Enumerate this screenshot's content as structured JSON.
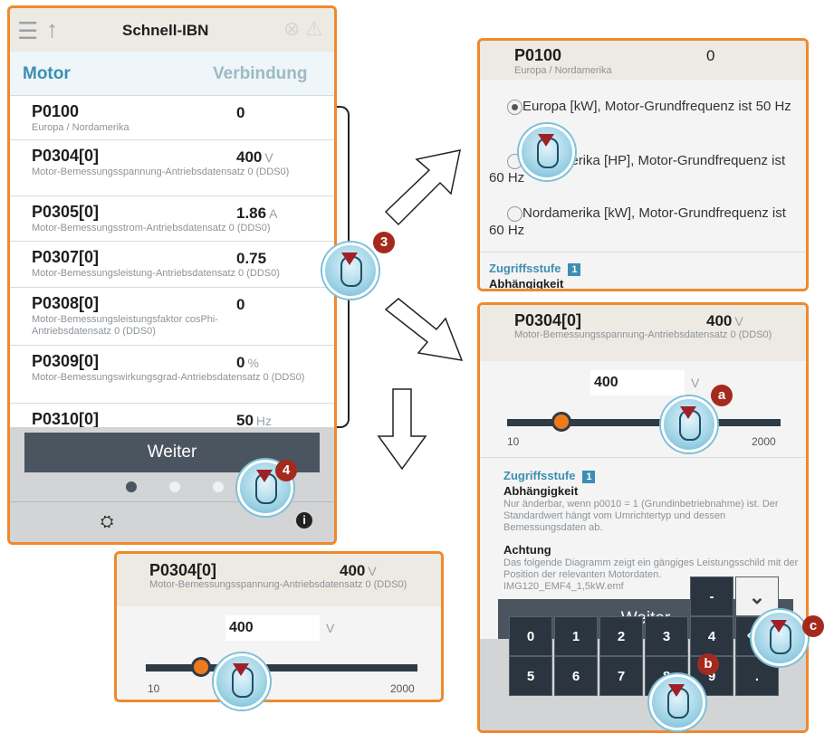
{
  "main": {
    "header_title": "Schnell-IBN",
    "tab_left": "Motor",
    "tab_right": "Verbindung",
    "params": [
      {
        "name": "P0100",
        "value": "0",
        "unit": "",
        "desc": "Europa / Nordamerika"
      },
      {
        "name": "P0304[0]",
        "value": "400",
        "unit": "V",
        "desc": "Motor-Bemessungsspannung-Antriebsdatensatz 0 (DDS0)"
      },
      {
        "name": "P0305[0]",
        "value": "1.86",
        "unit": "A",
        "desc": "Motor-Bemessungsstrom-Antriebsdatensatz 0 (DDS0)"
      },
      {
        "name": "P0307[0]",
        "value": "0.75",
        "unit": "",
        "desc": "Motor-Bemessungsleistung-Antriebsdatensatz 0 (DDS0)"
      },
      {
        "name": "P0308[0]",
        "value": "0",
        "unit": "",
        "desc": "Motor-Bemessungsleistungsfaktor cosPhi-Antriebsdatensatz 0 (DDS0)"
      },
      {
        "name": "P0309[0]",
        "value": "0",
        "unit": "%",
        "desc": "Motor-Bemessungswirkungsgrad-Antriebsdatensatz 0 (DDS0)"
      },
      {
        "name": "P0310[0]",
        "value": "50",
        "unit": "Hz",
        "desc": ""
      }
    ],
    "weiter_label": "Weiter",
    "page_indicator": {
      "total": 4,
      "active": 1
    }
  },
  "region_panel": {
    "param": "P0100",
    "value": "0",
    "desc": "Europa / Nordamerika",
    "options": [
      {
        "text": "Europa [kW], Motor-Grundfrequenz ist 50 Hz",
        "selected": true
      },
      {
        "text": "Nordamerika [HP], Motor-Grundfrequenz ist 60 Hz",
        "selected": false
      },
      {
        "text": "Nordamerika [kW], Motor-Grundfrequenz ist 60 Hz",
        "selected": false
      }
    ],
    "access_label": "Zugriffsstufe",
    "access_level": "1",
    "dependency_label": "Abhängigkeit"
  },
  "voltage_panel": {
    "param": "P0304[0]",
    "value": "400",
    "unit": "V",
    "desc": "Motor-Bemessungsspannung-Antriebsdatensatz 0 (DDS0)",
    "input_value": "400",
    "input_unit": "V",
    "slider_min": "10",
    "slider_max": "2000",
    "slider_fraction": 0.2,
    "access_label": "Zugriffsstufe",
    "access_level": "1",
    "dependency_label": "Abhängigkeit",
    "dependency_text": "Nur änderbar, wenn p0010 = 1 (Grundinbetriebnahme) ist. Der Standardwert hängt vom Umrichtertyp und dessen Bemessungsdaten ab.",
    "warning_label": "Achtung",
    "warning_text": "Das folgende Diagramm zeigt ein gängiges Leistungsschild mit der Position der relevanten Motordaten.",
    "warning_file": "IMG120_EMF4_1,5kW.emf",
    "weiter_label": "Weiter",
    "keypad_top": [
      "-",
      "⌄"
    ],
    "keypad_row1": [
      "0",
      "1",
      "2",
      "3",
      "4",
      "⌫"
    ],
    "keypad_row2": [
      "5",
      "6",
      "7",
      "8",
      "9",
      "."
    ]
  },
  "small_panel": {
    "param": "P0304[0]",
    "value": "400",
    "unit": "V",
    "desc": "Motor-Bemessungsspannung-Antriebsdatensatz 0 (DDS0)",
    "input_value": "400",
    "input_unit": "V",
    "slider_min": "10",
    "slider_max": "2000"
  },
  "badges": [
    "3",
    "4",
    "a",
    "b",
    "c"
  ],
  "colors": {
    "accent_orange": "#ee8a2d",
    "link_blue": "#3c8fb2",
    "header_bg": "#eceae2",
    "badge_red": "#a42a1e",
    "keypad": "#2a3540"
  }
}
